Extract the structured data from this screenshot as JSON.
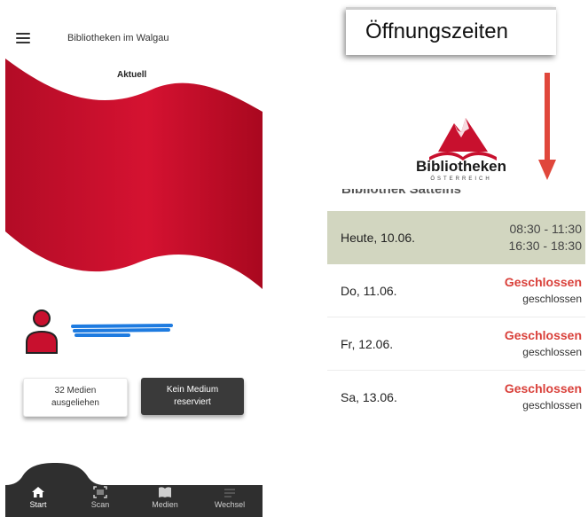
{
  "phone": {
    "app_title": "Bibliotheken im Walgau",
    "section_title": "Aktuell",
    "cards": {
      "borrowed": [
        "32 Medien",
        "ausgeliehen"
      ],
      "reserved": [
        "Kein Medium",
        "reserviert"
      ]
    },
    "nav": [
      "Start",
      "Scan",
      "Medien",
      "Wechsel"
    ],
    "colors": {
      "flag_red": "#c8102e",
      "nav_bg": "#2f2f2f",
      "user_icon": "#c8102e",
      "redact_blue": "#1e7be0"
    }
  },
  "annotation": {
    "callout_label": "Öffnungszeiten",
    "arrow_color": "#e0473b"
  },
  "logo": {
    "name": "Bibliotheken",
    "sub": "ÖSTERREICH"
  },
  "hours": {
    "cut_header": "Bibliothek Satteins",
    "rows": [
      {
        "day": "Heute, 10.06.",
        "line1": "08:30 - 11:30",
        "line2": "16:30 - 18:30"
      },
      {
        "day": "Do, 11.06.",
        "line1": "Geschlossen",
        "line2": "geschlossen"
      },
      {
        "day": "Fr, 12.06.",
        "line1": "Geschlossen",
        "line2": "geschlossen"
      },
      {
        "day": "Sa, 13.06.",
        "line1": "Geschlossen",
        "line2": "geschlossen"
      }
    ]
  }
}
